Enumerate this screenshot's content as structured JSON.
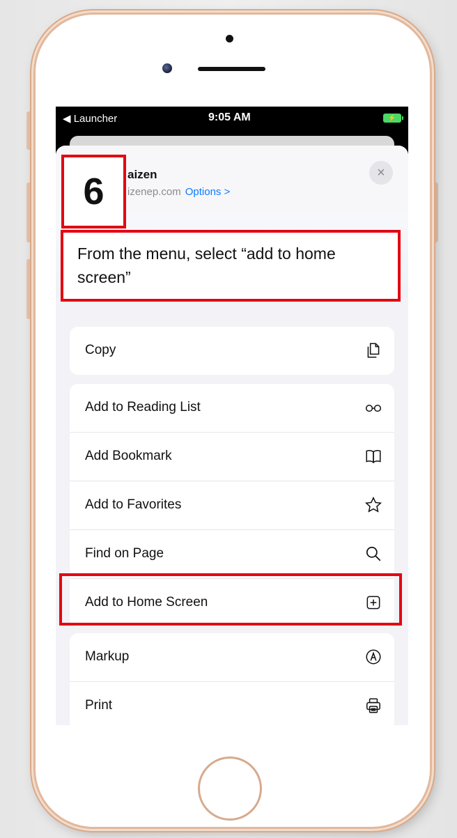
{
  "status_bar": {
    "back_label": "◀ Launcher",
    "time": "9:05 AM"
  },
  "share_sheet": {
    "site_title": "aizen",
    "site_url": "izenep.com",
    "options_label": "Options >",
    "close_label": "×",
    "groups": [
      {
        "items": [
          {
            "label": "Copy",
            "icon": "copy-icon"
          }
        ]
      },
      {
        "items": [
          {
            "label": "Add to Reading List",
            "icon": "glasses-icon"
          },
          {
            "label": "Add Bookmark",
            "icon": "book-icon"
          },
          {
            "label": "Add to Favorites",
            "icon": "star-icon"
          },
          {
            "label": "Find on Page",
            "icon": "search-icon"
          },
          {
            "label": "Add to Home Screen",
            "icon": "plus-square-icon"
          }
        ]
      },
      {
        "items": [
          {
            "label": "Markup",
            "icon": "markup-icon"
          },
          {
            "label": "Print",
            "icon": "printer-icon"
          }
        ]
      }
    ]
  },
  "tutorial": {
    "step_number": "6",
    "instruction": "From the menu, select “add to home screen”",
    "highlight_color": "#e30613"
  }
}
